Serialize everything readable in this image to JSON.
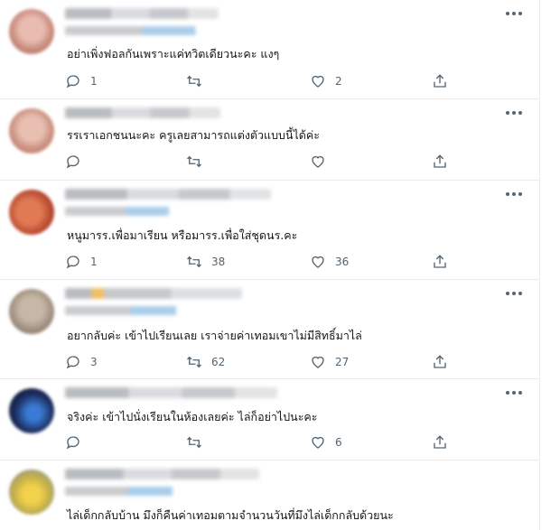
{
  "tweets": [
    {
      "text": "อย่าเพิ่งฟอลกันเพราะแค่ทวิตเดียวนะคะ แงๆ",
      "reply_count": "1",
      "retweet_count": "",
      "like_count": "2",
      "avatar_color": "#d7a296"
    },
    {
      "text": "รรเราเอกชนนะคะ ครูเลยสามารถแต่งตัวแบบนี้ได้ค่ะ",
      "reply_count": "",
      "retweet_count": "",
      "like_count": "",
      "avatar_color": "#d3a594"
    },
    {
      "text": "หนูมารร.เพื่อมาเรียน หรือมารร.เพื่อใส่ชุดนร.คะ",
      "reply_count": "1",
      "retweet_count": "38",
      "like_count": "36",
      "avatar_color": "#c75a3e"
    },
    {
      "text": "อยากลับค่ะ เข้าไปเรียนเลย เราจ่ายค่าเทอมเขาไม่มีสิทธิ์มาไล่",
      "reply_count": "3",
      "retweet_count": "62",
      "like_count": "27",
      "avatar_color": "#a39689"
    },
    {
      "text": "จริงค่ะ เข้าไปนั่งเรียนในห้องเลยค่ะ ไล่ก็อย่าไปนะคะ",
      "reply_count": "",
      "retweet_count": "",
      "like_count": "6",
      "avatar_color": "#1c2a52"
    },
    {
      "text": "ไล่เด็กกลับบ้าน มึงก็คืนค่าเทอมตามจำนวนวันที่มึงไล่เด็กกลับด้วยนะ",
      "reply_count": "",
      "retweet_count": "",
      "like_count": "",
      "avatar_color": "#c9b24a"
    }
  ]
}
